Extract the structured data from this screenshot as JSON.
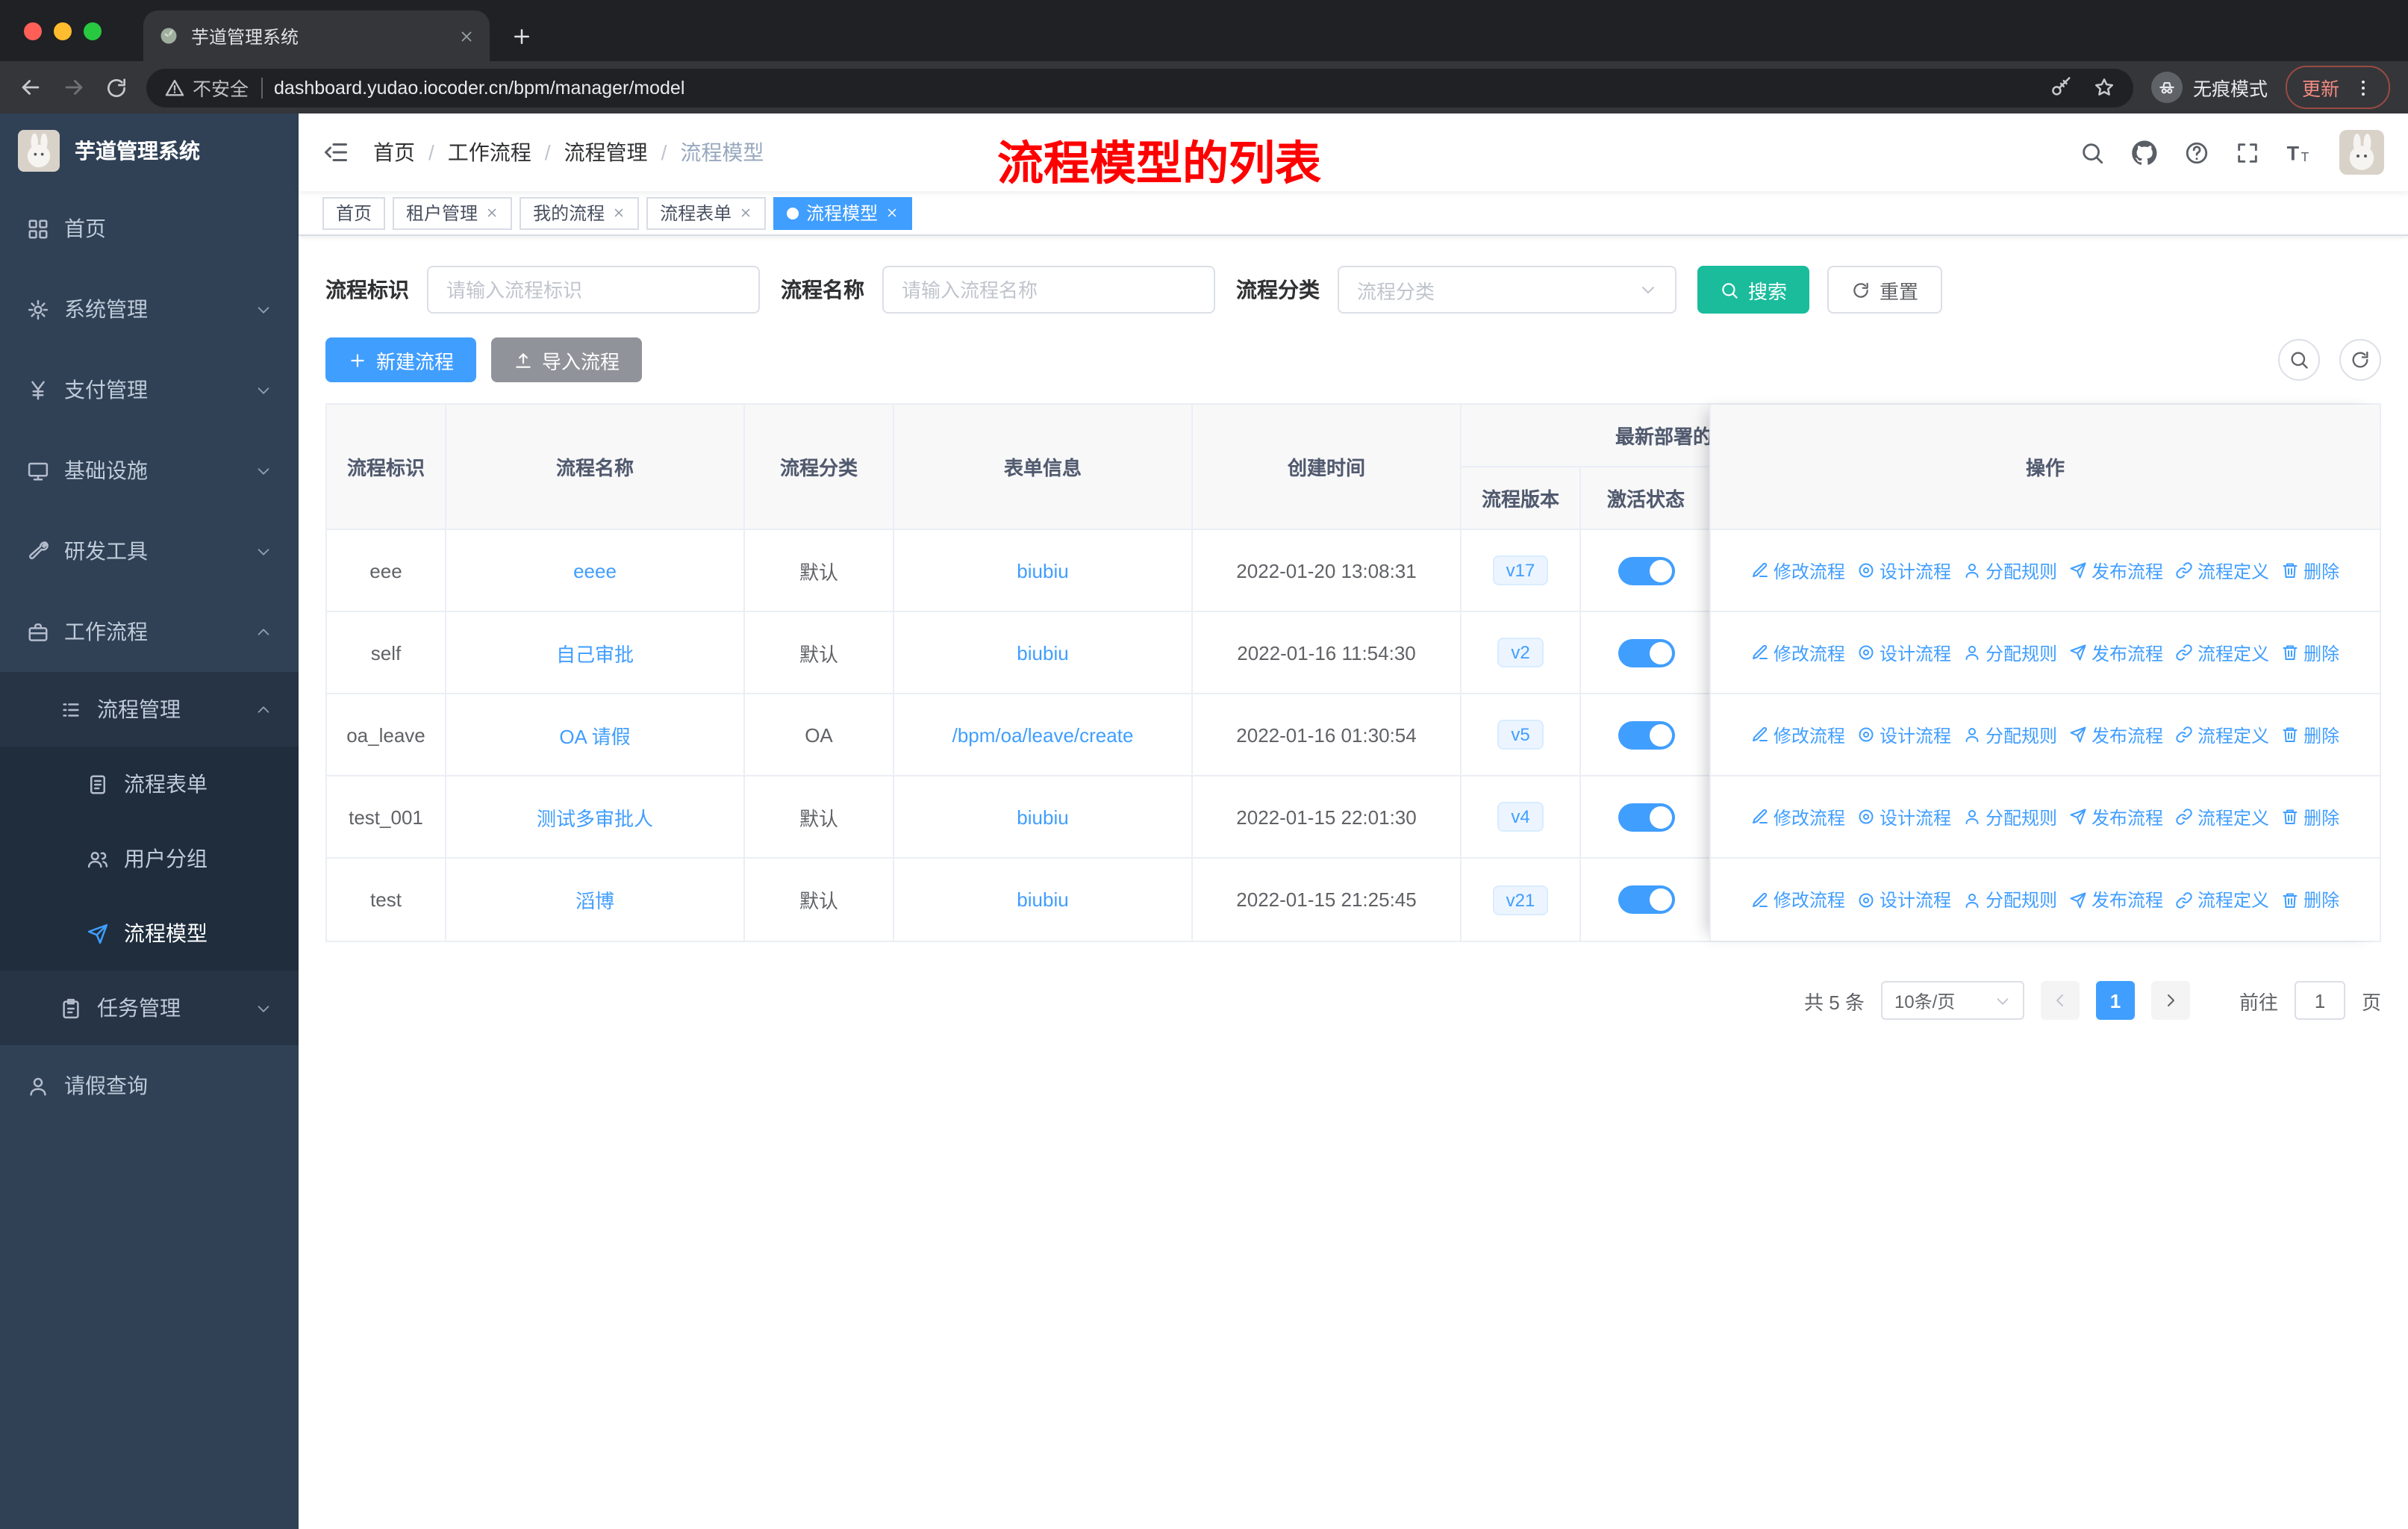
{
  "browser": {
    "tab_title": "芋道管理系统",
    "security_label": "不安全",
    "url": "dashboard.yudao.iocoder.cn/bpm/manager/model",
    "incognito_label": "无痕模式",
    "update_label": "更新"
  },
  "sidebar": {
    "logo_title": "芋道管理系统",
    "items": [
      {
        "label": "首页",
        "icon": "dashboard-icon",
        "level": 1
      },
      {
        "label": "系统管理",
        "icon": "gear-icon",
        "level": 1,
        "chevron": "down"
      },
      {
        "label": "支付管理",
        "icon": "yen-icon",
        "level": 1,
        "chevron": "down"
      },
      {
        "label": "基础设施",
        "icon": "monitor-icon",
        "level": 1,
        "chevron": "down"
      },
      {
        "label": "研发工具",
        "icon": "tools-icon",
        "level": 1,
        "chevron": "down"
      },
      {
        "label": "工作流程",
        "icon": "briefcase-icon",
        "level": 1,
        "chevron": "up"
      },
      {
        "label": "流程管理",
        "icon": "tree-icon",
        "level": 2,
        "chevron": "up"
      },
      {
        "label": "流程表单",
        "icon": "form-icon",
        "level": 3
      },
      {
        "label": "用户分组",
        "icon": "users-icon",
        "level": 3
      },
      {
        "label": "流程模型",
        "icon": "plane-icon",
        "level": 3,
        "active": true
      },
      {
        "label": "任务管理",
        "icon": "task-icon",
        "level": 2,
        "chevron": "down"
      },
      {
        "label": "请假查询",
        "icon": "user-icon",
        "level": 1
      }
    ]
  },
  "header": {
    "breadcrumb": [
      "首页",
      "工作流程",
      "流程管理",
      "流程模型"
    ],
    "annotation": "流程模型的列表"
  },
  "tags": [
    {
      "label": "首页",
      "closable": false,
      "active": false
    },
    {
      "label": "租户管理",
      "closable": true,
      "active": false
    },
    {
      "label": "我的流程",
      "closable": true,
      "active": false
    },
    {
      "label": "流程表单",
      "closable": true,
      "active": false
    },
    {
      "label": "流程模型",
      "closable": true,
      "active": true
    }
  ],
  "filters": {
    "id_label": "流程标识",
    "id_placeholder": "请输入流程标识",
    "name_label": "流程名称",
    "name_placeholder": "请输入流程名称",
    "category_label": "流程分类",
    "category_placeholder": "流程分类",
    "search_label": "搜索",
    "reset_label": "重置"
  },
  "toolbar": {
    "create_label": "新建流程",
    "import_label": "导入流程"
  },
  "table": {
    "col_id": "流程标识",
    "col_name": "流程名称",
    "col_category": "流程分类",
    "col_form": "表单信息",
    "col_created": "创建时间",
    "col_group": "最新部署的",
    "col_version": "流程版本",
    "col_status": "激活状态",
    "col_actions": "操作",
    "actions": [
      {
        "label": "修改流程",
        "icon": "edit-icon"
      },
      {
        "label": "设计流程",
        "icon": "design-icon"
      },
      {
        "label": "分配规则",
        "icon": "assign-icon"
      },
      {
        "label": "发布流程",
        "icon": "publish-icon"
      },
      {
        "label": "流程定义",
        "icon": "definition-icon"
      },
      {
        "label": "删除",
        "icon": "trash-icon"
      }
    ],
    "rows": [
      {
        "id": "eee",
        "name": "eeee",
        "category": "默认",
        "form": "biubiu",
        "created": "2022-01-20 13:08:31",
        "version": "v17",
        "active": true
      },
      {
        "id": "self",
        "name": "自己审批",
        "category": "默认",
        "form": "biubiu",
        "created": "2022-01-16 11:54:30",
        "version": "v2",
        "active": true
      },
      {
        "id": "oa_leave",
        "name": "OA 请假",
        "category": "OA",
        "form": "/bpm/oa/leave/create",
        "created": "2022-01-16 01:30:54",
        "version": "v5",
        "active": true
      },
      {
        "id": "test_001",
        "name": "测试多审批人",
        "category": "默认",
        "form": "biubiu",
        "created": "2022-01-15 22:01:30",
        "version": "v4",
        "active": true
      },
      {
        "id": "test",
        "name": "滔博",
        "category": "默认",
        "form": "biubiu",
        "created": "2022-01-15 21:25:45",
        "version": "v21",
        "active": true
      }
    ]
  },
  "pagination": {
    "total": "共 5 条",
    "page_size": "10条/页",
    "current_page": "1",
    "goto_label": "前往",
    "goto_value": "1",
    "page_unit": "页"
  },
  "colors": {
    "accent": "#409eff",
    "search_button": "#1abc9c",
    "annotation": "#ff0000",
    "sidebar_bg": "#304156"
  }
}
